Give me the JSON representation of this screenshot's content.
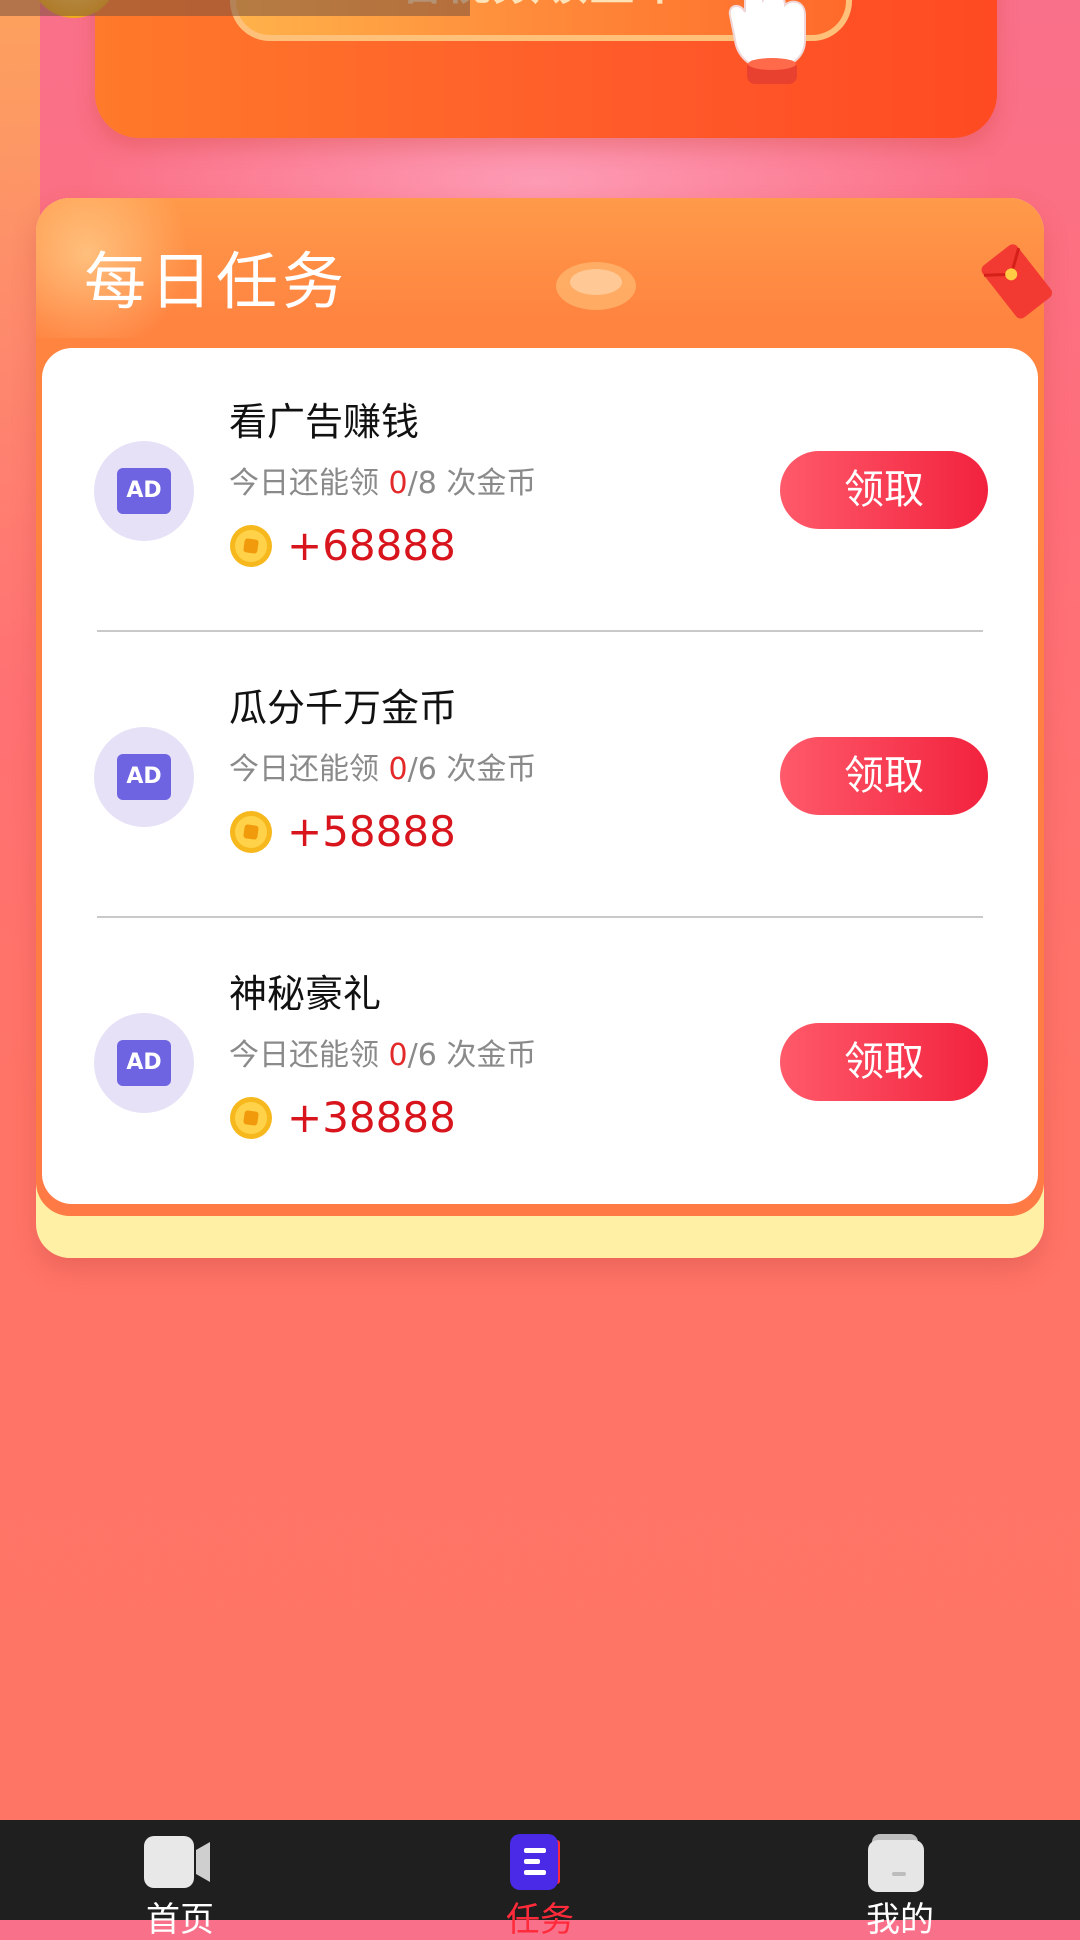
{
  "banner": {
    "button_text": "看视频领金币"
  },
  "daily_tasks": {
    "title": "每日任务",
    "tasks": [
      {
        "name": "看广告赚钱",
        "sub_prefix": "今日还能领 ",
        "done": "0",
        "sub_suffix": "/8 次金币",
        "reward": "+68888",
        "button": "领取",
        "ad_label": "AD"
      },
      {
        "name": "瓜分千万金币",
        "sub_prefix": "今日还能领 ",
        "done": "0",
        "sub_suffix": "/6 次金币",
        "reward": "+58888",
        "button": "领取",
        "ad_label": "AD"
      },
      {
        "name": "神秘豪礼",
        "sub_prefix": "今日还能领 ",
        "done": "0",
        "sub_suffix": "/6 次金币",
        "reward": "+38888",
        "button": "领取",
        "ad_label": "AD"
      }
    ]
  },
  "bottom_nav": {
    "items": [
      {
        "label": "首页",
        "icon": "video-camera-icon",
        "active": false
      },
      {
        "label": "任务",
        "icon": "task-list-icon",
        "active": true
      },
      {
        "label": "我的",
        "icon": "profile-folder-icon",
        "active": false
      }
    ]
  },
  "colors": {
    "accent_red": "#d8141c",
    "button_red": "#f2223e",
    "card_orange": "#ff8440",
    "nav_bg": "#1f1f1f"
  }
}
